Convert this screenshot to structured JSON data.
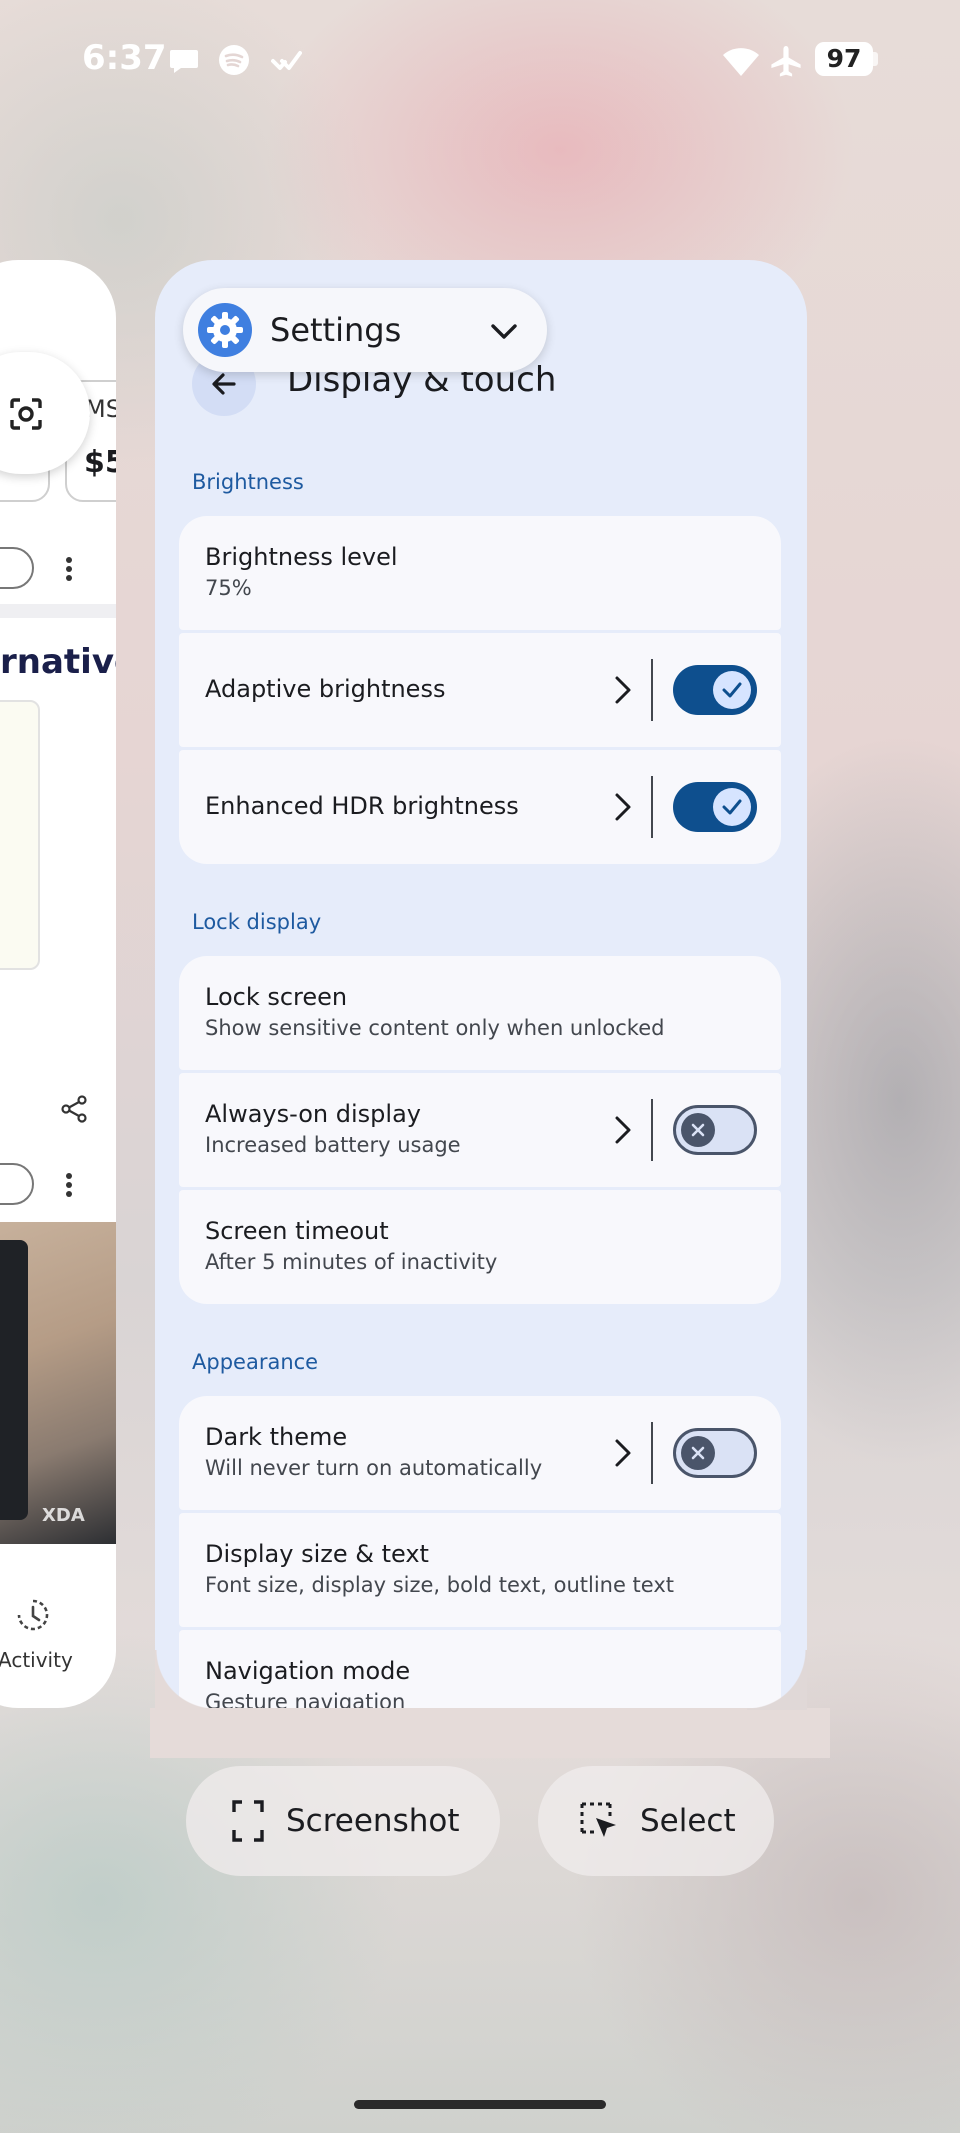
{
  "status_bar": {
    "time": "6:37",
    "battery": "97",
    "icons": [
      "messages-icon",
      "spotify-icon",
      "check-icon",
      "wifi-icon",
      "airplane-icon",
      "battery-icon"
    ]
  },
  "left_app": {
    "price_fragment": "$5",
    "ticker_fragment": "MS",
    "heading_fragment": "rnative",
    "activity_label": "Activity",
    "watermark": "XDA"
  },
  "app_chip": {
    "name": "Settings"
  },
  "page": {
    "title": "Display & touch"
  },
  "sections": [
    {
      "label": "Brightness",
      "items": [
        {
          "title": "Brightness level",
          "subtitle": "75%"
        },
        {
          "title": "Adaptive brightness",
          "toggle": "on"
        },
        {
          "title": "Enhanced HDR brightness",
          "toggle": "on"
        }
      ]
    },
    {
      "label": "Lock display",
      "items": [
        {
          "title": "Lock screen",
          "subtitle": "Show sensitive content only when unlocked"
        },
        {
          "title": "Always-on display",
          "subtitle": "Increased battery usage",
          "toggle": "off"
        },
        {
          "title": "Screen timeout",
          "subtitle": "After 5 minutes of inactivity"
        }
      ]
    },
    {
      "label": "Appearance",
      "items": [
        {
          "title": "Dark theme",
          "subtitle": "Will never turn on automatically",
          "toggle": "off"
        },
        {
          "title": "Display size & text",
          "subtitle": "Font size, display size, bold text, outline text"
        },
        {
          "title": "Navigation mode",
          "subtitle": "Gesture navigation"
        }
      ]
    }
  ],
  "actions": {
    "screenshot": "Screenshot",
    "select": "Select"
  },
  "colors": {
    "accent": "#0e4f8e",
    "section_label": "#1e5aa0",
    "card_bg": "#e6ecfa",
    "row_bg": "#f8f8fc"
  }
}
